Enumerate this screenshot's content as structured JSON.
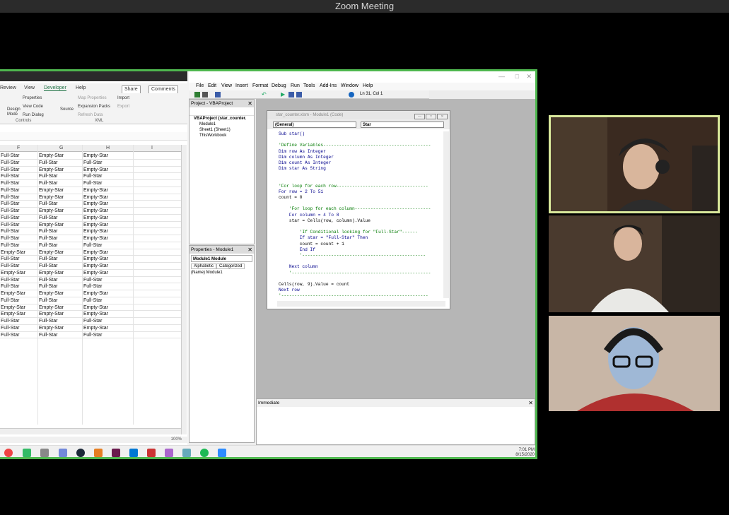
{
  "zoom": {
    "title": "Zoom Meeting"
  },
  "excel": {
    "ribbon_tabs": [
      "Review",
      "View",
      "Developer",
      "Help"
    ],
    "share_label": "Share",
    "comments_label": "Comments",
    "ribbon_items": {
      "properties": "Properties",
      "view_code": "View Code",
      "run_dialog": "Run Dialog",
      "design_mode": "Design Mode",
      "source": "Source",
      "map_properties": "Map Properties",
      "expansion_packs": "Expansion Packs",
      "refresh_data": "Refresh Data",
      "import": "Import",
      "export": "Export",
      "controls_group": "Controls",
      "xml_group": "XML"
    },
    "columns": [
      "F",
      "G",
      "H",
      "I"
    ],
    "rows": [
      [
        "Full-Star",
        "Empty-Star",
        "Empty-Star"
      ],
      [
        "Full-Star",
        "Full-Star",
        "Full-Star"
      ],
      [
        "Full-Star",
        "Empty-Star",
        "Empty-Star"
      ],
      [
        "Full-Star",
        "Full-Star",
        "Full-Star"
      ],
      [
        "Full-Star",
        "Full-Star",
        "Full-Star"
      ],
      [
        "Full-Star",
        "Empty-Star",
        "Empty-Star"
      ],
      [
        "Full-Star",
        "Empty-Star",
        "Empty-Star"
      ],
      [
        "Full-Star",
        "Full-Star",
        "Empty-Star"
      ],
      [
        "Full-Star",
        "Empty-Star",
        "Empty-Star"
      ],
      [
        "Full-Star",
        "Full-Star",
        "Empty-Star"
      ],
      [
        "Full-Star",
        "Empty-Star",
        "Empty-Star"
      ],
      [
        "Full-Star",
        "Full-Star",
        "Empty-Star"
      ],
      [
        "Full-Star",
        "Full-Star",
        "Empty-Star"
      ],
      [
        "Full-Star",
        "Full-Star",
        "Full-Star"
      ],
      [
        "Empty-Star",
        "Empty-Star",
        "Empty-Star"
      ],
      [
        "Full-Star",
        "Full-Star",
        "Empty-Star"
      ],
      [
        "Full-Star",
        "Full-Star",
        "Empty-Star"
      ],
      [
        "Empty-Star",
        "Empty-Star",
        "Empty-Star"
      ],
      [
        "Full-Star",
        "Full-Star",
        "Full-Star"
      ],
      [
        "Full-Star",
        "Full-Star",
        "Full-Star"
      ],
      [
        "Empty-Star",
        "Empty-Star",
        "Empty-Star"
      ],
      [
        "Full-Star",
        "Full-Star",
        "Full-Star"
      ],
      [
        "Empty-Star",
        "Empty-Star",
        "Empty-Star"
      ],
      [
        "Empty-Star",
        "Empty-Star",
        "Empty-Star"
      ],
      [
        "Full-Star",
        "Full-Star",
        "Full-Star"
      ],
      [
        "Full-Star",
        "Empty-Star",
        "Empty-Star"
      ],
      [
        "Full-Star",
        "Full-Star",
        "Full-Star"
      ]
    ],
    "zoom_level": "100%"
  },
  "vba": {
    "menu": [
      "File",
      "Edit",
      "View",
      "Insert",
      "Format",
      "Debug",
      "Run",
      "Tools",
      "Add-Ins",
      "Window",
      "Help"
    ],
    "status": "Ln 31, Col 1",
    "project_panel_title": "Project - VBAProject",
    "project_tree": [
      "VBAProject (star_counter.",
      "Module1",
      "Sheet1 (Sheet1)",
      "ThisWorkbook"
    ],
    "properties_panel_title": "Properties - Module1",
    "properties_object": "Module1 Module",
    "properties_tabs": [
      "Alphabetic",
      "Categorized"
    ],
    "properties_row": "(Name)  Module1",
    "code_window_title": "star_counter.xlsm - Module1 (Code)",
    "object_select": "(General)",
    "proc_select": "Star",
    "immediate_title": "Immediate",
    "code_lines": [
      {
        "t": "Sub star()",
        "c": "kw"
      },
      {
        "t": "",
        "c": ""
      },
      {
        "t": "'Define Variables-----------------------------------------",
        "c": "cm"
      },
      {
        "t": "Dim row As Integer",
        "c": "kw"
      },
      {
        "t": "Dim column As Integer",
        "c": "kw"
      },
      {
        "t": "Dim count As Integer",
        "c": "kw"
      },
      {
        "t": "Dim star As String",
        "c": "kw"
      },
      {
        "t": "",
        "c": ""
      },
      {
        "t": "",
        "c": ""
      },
      {
        "t": "'For loop for each row-----------------------------------",
        "c": "cm"
      },
      {
        "t": "For row = 2 To 51",
        "c": "kw"
      },
      {
        "t": "count = 0",
        "c": ""
      },
      {
        "t": "",
        "c": ""
      },
      {
        "t": "    'For loop for each column-----------------------------",
        "c": "cm"
      },
      {
        "t": "    For column = 4 To 8",
        "c": "kw"
      },
      {
        "t": "    star = Cells(row, column).Value",
        "c": ""
      },
      {
        "t": "",
        "c": ""
      },
      {
        "t": "        'If Conditional looking for \"Full-Star\"------",
        "c": "cm"
      },
      {
        "t": "        If star = \"Full-Star\" Then",
        "c": "kw"
      },
      {
        "t": "        count = count + 1",
        "c": ""
      },
      {
        "t": "        End If",
        "c": "kw"
      },
      {
        "t": "        '-----------------------------------------------",
        "c": "cm"
      },
      {
        "t": "",
        "c": ""
      },
      {
        "t": "    Next column",
        "c": "kw"
      },
      {
        "t": "    '-----------------------------------------------------",
        "c": "cm"
      },
      {
        "t": "",
        "c": ""
      },
      {
        "t": "Cells(row, 9).Value = count",
        "c": ""
      },
      {
        "t": "Next row",
        "c": "kw"
      },
      {
        "t": "'--------------------------------------------------------",
        "c": "cm"
      }
    ]
  },
  "taskbar": {
    "time": "7:01 PM",
    "date": "8/15/2020"
  }
}
